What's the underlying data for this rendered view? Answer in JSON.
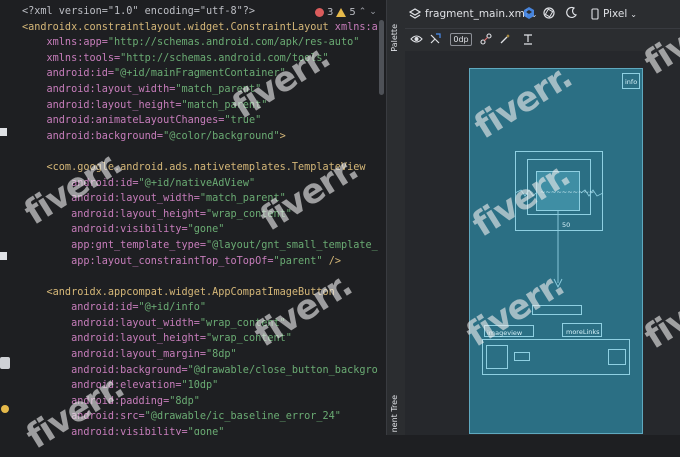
{
  "editor": {
    "lines": [
      [
        {
          "t": "<?xml version=\"1.0\" encoding=\"utf-8\"?>",
          "c": "plain"
        }
      ],
      [
        {
          "t": "<androidx.constraintlayout.widget.ConstraintLayout",
          "c": "tag"
        },
        {
          "t": " xmlns:android=",
          "c": "attr"
        }
      ],
      [
        {
          "t": "    xmlns:app=",
          "c": "attr"
        },
        {
          "t": "\"http://schemas.android.com/apk/res-auto\"",
          "c": "val"
        }
      ],
      [
        {
          "t": "    xmlns:tools=",
          "c": "attr"
        },
        {
          "t": "\"http://schemas.android.com/tools\"",
          "c": "val"
        }
      ],
      [
        {
          "t": "    android:id=",
          "c": "attr"
        },
        {
          "t": "\"@+id/mainFragmentContainer\"",
          "c": "val"
        }
      ],
      [
        {
          "t": "    android:layout_width=",
          "c": "attr"
        },
        {
          "t": "\"match_parent\"",
          "c": "val"
        }
      ],
      [
        {
          "t": "    android:layout_height=",
          "c": "attr"
        },
        {
          "t": "\"match_parent\"",
          "c": "val"
        }
      ],
      [
        {
          "t": "    android:animateLayoutChanges=",
          "c": "attr"
        },
        {
          "t": "\"true\"",
          "c": "val"
        }
      ],
      [
        {
          "t": "    android:background=",
          "c": "attr"
        },
        {
          "t": "\"@color/background\"",
          "c": "val"
        },
        {
          "t": ">",
          "c": "tag"
        }
      ],
      [
        {
          "t": "",
          "c": "plain"
        }
      ],
      [
        {
          "t": "    <com.google.android.ads.nativetemplates.TemplateView",
          "c": "tag"
        }
      ],
      [
        {
          "t": "        android:id=",
          "c": "attr"
        },
        {
          "t": "\"@+id/nativeAdView\"",
          "c": "val"
        }
      ],
      [
        {
          "t": "        android:layout_width=",
          "c": "attr"
        },
        {
          "t": "\"match_parent\"",
          "c": "val"
        }
      ],
      [
        {
          "t": "        android:layout_height=",
          "c": "attr"
        },
        {
          "t": "\"wrap_content\"",
          "c": "val"
        }
      ],
      [
        {
          "t": "        android:visibility=",
          "c": "attr"
        },
        {
          "t": "\"gone\"",
          "c": "val"
        }
      ],
      [
        {
          "t": "        app:gnt_template_type=",
          "c": "attr"
        },
        {
          "t": "\"@layout/gnt_small_template_view\"",
          "c": "val"
        }
      ],
      [
        {
          "t": "        app:layout_constraintTop_toTopOf=",
          "c": "attr"
        },
        {
          "t": "\"parent\"",
          "c": "val"
        },
        {
          "t": " />",
          "c": "tag"
        }
      ],
      [
        {
          "t": "",
          "c": "plain"
        }
      ],
      [
        {
          "t": "    <androidx.appcompat.widget.AppCompatImageButton",
          "c": "tag"
        }
      ],
      [
        {
          "t": "        android:id=",
          "c": "attr"
        },
        {
          "t": "\"@+id/info\"",
          "c": "val"
        }
      ],
      [
        {
          "t": "        android:layout_width=",
          "c": "attr"
        },
        {
          "t": "\"wrap_content\"",
          "c": "val"
        }
      ],
      [
        {
          "t": "        android:layout_height=",
          "c": "attr"
        },
        {
          "t": "\"wrap_content\"",
          "c": "val"
        }
      ],
      [
        {
          "t": "        android:layout_margin=",
          "c": "attr"
        },
        {
          "t": "\"8dp\"",
          "c": "val"
        }
      ],
      [
        {
          "t": "        android:background=",
          "c": "attr"
        },
        {
          "t": "\"@drawable/close_button_background\"",
          "c": "val"
        }
      ],
      [
        {
          "t": "        android:elevation=",
          "c": "attr"
        },
        {
          "t": "\"10dp\"",
          "c": "val"
        }
      ],
      [
        {
          "t": "        android:padding=",
          "c": "attr"
        },
        {
          "t": "\"8dp\"",
          "c": "val"
        }
      ],
      [
        {
          "t": "        android:src=",
          "c": "attr"
        },
        {
          "t": "\"@drawable/ic_baseline_error_24\"",
          "c": "val"
        }
      ],
      [
        {
          "t": "        android:visibility=",
          "c": "attr"
        },
        {
          "t": "\"gone\"",
          "c": "val"
        }
      ]
    ],
    "error_count": "3",
    "warning_count": "5"
  },
  "tool_strip": {
    "palette_label": "Palette",
    "tree_label": "nent Tree"
  },
  "design": {
    "file_name": "fragment_main.xml",
    "device_label": "Pixel",
    "default_margin": "0dp",
    "blueprint": {
      "info_label": "info",
      "constraint_value": "50",
      "left_label": "imageview",
      "more_label": "moreLinks"
    }
  },
  "watermark": "fiverr."
}
